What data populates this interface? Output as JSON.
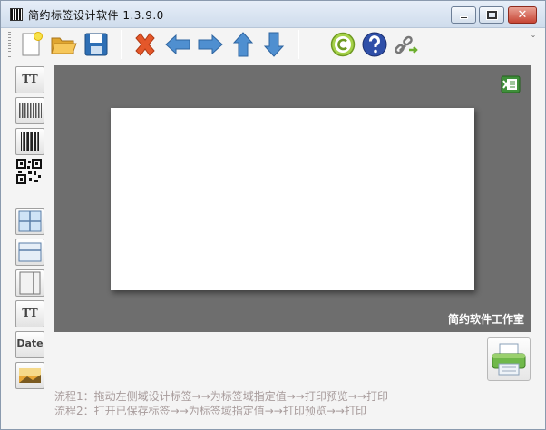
{
  "window": {
    "title": "简约标签设计软件  1.3.9.0",
    "close_glyph": "✕"
  },
  "toolbar": {
    "buttons": [
      "new-file",
      "open-folder",
      "save",
      "delete",
      "arrow-left",
      "arrow-right",
      "arrow-up",
      "arrow-down",
      "copyright",
      "help",
      "link"
    ],
    "scroll_glyph": "⌄"
  },
  "palette": {
    "items": [
      {
        "name": "text-tool",
        "label": "TT"
      },
      {
        "name": "barcode-1d-wide"
      },
      {
        "name": "barcode-1d"
      },
      {
        "name": "qr-code"
      },
      {
        "name": "grid-4-cells"
      },
      {
        "name": "grid-2-rows"
      },
      {
        "name": "grid-2-cols"
      },
      {
        "name": "text-field",
        "label": "TT"
      },
      {
        "name": "date-field",
        "label": "Date"
      },
      {
        "name": "image-field"
      }
    ]
  },
  "canvas": {
    "studio_label": "简约软件工作室",
    "background_color": "#6e6e6e"
  },
  "footer": {
    "flow1": "流程1：拖动左侧域设计标签→→为标签域指定值→→打印预览→→打印",
    "flow2": "流程2：打开已保存标签→→为标签域指定值→→打印预览→→打印"
  }
}
